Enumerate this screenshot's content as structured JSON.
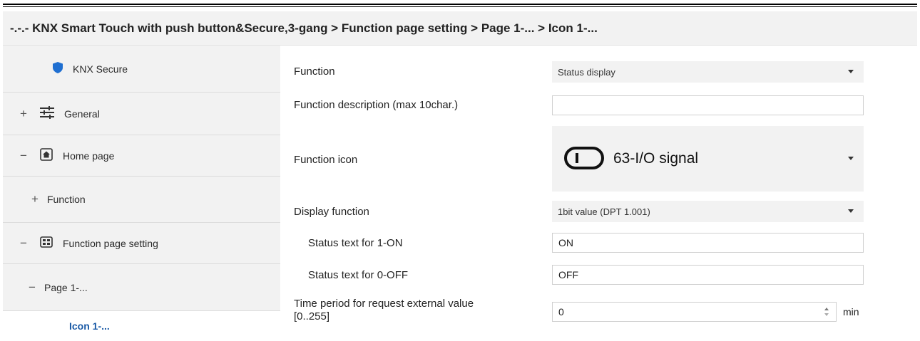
{
  "breadcrumb": "-.-.- KNX Smart Touch with push button&Secure,3-gang > Function page setting > Page 1-... > Icon 1-...",
  "sidebar": {
    "items": [
      {
        "toggle": "",
        "icon": "shield-icon",
        "label": "KNX Secure"
      },
      {
        "toggle": "+",
        "icon": "sliders-icon",
        "label": "General"
      },
      {
        "toggle": "−",
        "icon": "home-icon",
        "label": "Home page"
      },
      {
        "toggle": "+",
        "icon": "",
        "label": "Function"
      },
      {
        "toggle": "−",
        "icon": "grid-icon",
        "label": "Function page setting"
      },
      {
        "toggle": "−",
        "icon": "",
        "label": "Page 1-..."
      },
      {
        "toggle": "",
        "icon": "",
        "label": "Icon 1-..."
      }
    ]
  },
  "form": {
    "function": {
      "label": "Function",
      "value": "Status display"
    },
    "description": {
      "label": "Function description (max 10char.)",
      "value": ""
    },
    "icon": {
      "label": "Function icon",
      "value": "63-I/O signal",
      "icon": "toggle-switch-icon"
    },
    "display_function": {
      "label": "Display function",
      "value": "1bit value (DPT 1.001)"
    },
    "status_on": {
      "label": "Status text for 1-ON",
      "value": "ON"
    },
    "status_off": {
      "label": "Status text for 0-OFF",
      "value": "OFF"
    },
    "time_period": {
      "label_line1": "Time period for request external value",
      "label_line2": "[0..255]",
      "value": "0",
      "unit": "min"
    }
  },
  "colors": {
    "accent": "#1a5aa6",
    "shield": "#1f6fd1",
    "panel": "#f2f2f2"
  }
}
